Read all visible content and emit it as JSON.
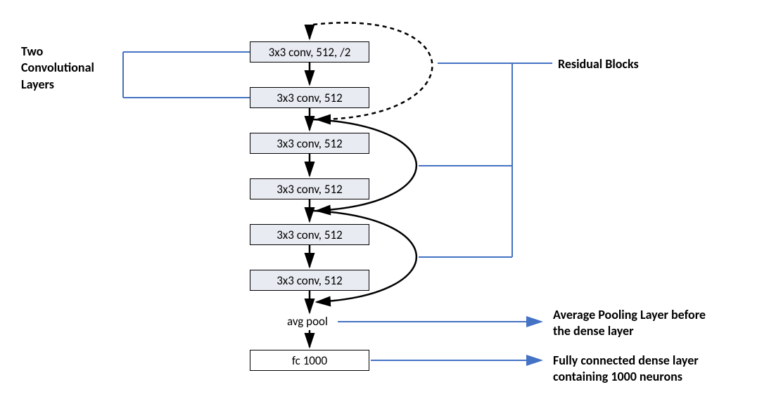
{
  "boxes": {
    "b1": "3x3 conv, 512, /2",
    "b2": "3x3 conv, 512",
    "b3": "3x3 conv, 512",
    "b4": "3x3 conv, 512",
    "b5": "3x3 conv, 512",
    "b6": "3x3 conv, 512",
    "avgpool": "avg pool",
    "fc": "fc 1000"
  },
  "labels": {
    "left_top_1": "Two",
    "left_top_2": "Convolutional",
    "left_top_3": "Layers",
    "right_top": "Residual Blocks",
    "right_avg_1": "Average Pooling Layer before",
    "right_avg_2": "the dense layer",
    "right_fc_1": "Fully connected dense layer",
    "right_fc_2": "containing 1000 neurons"
  }
}
